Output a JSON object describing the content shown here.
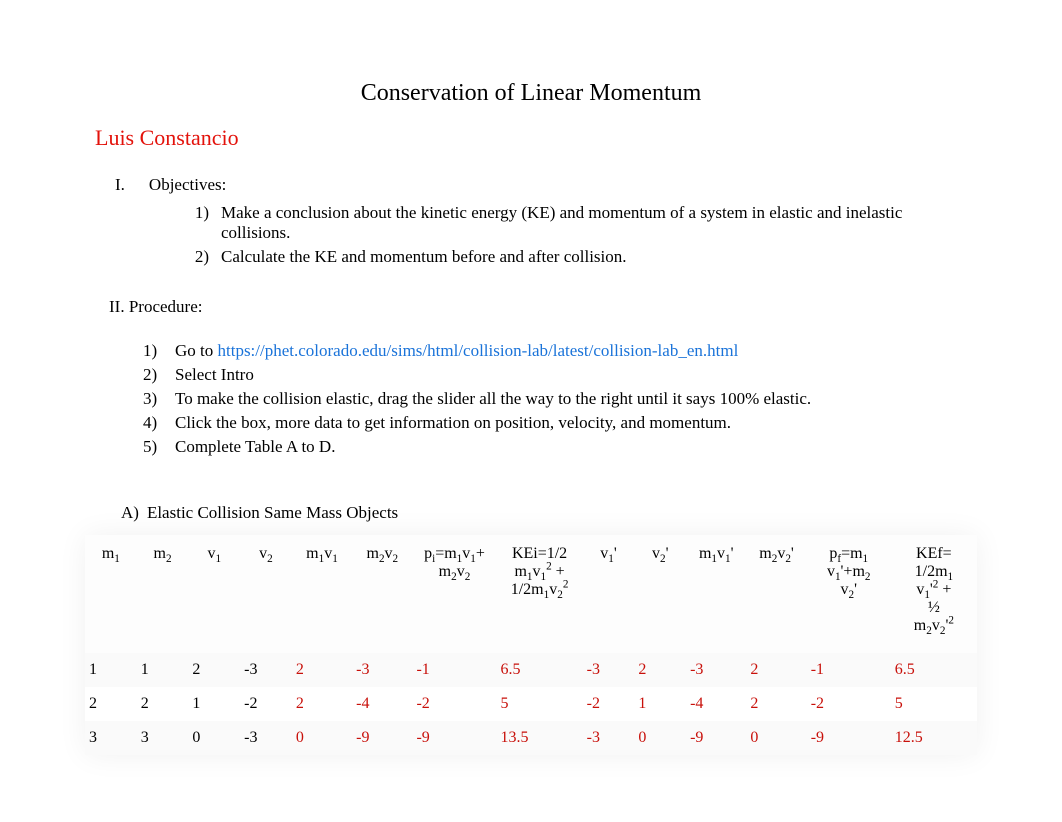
{
  "title": "Conservation of Linear Momentum",
  "author": "Luis Constancio",
  "obj_roman": "I.",
  "obj_label": "Objectives:",
  "objectives": [
    {
      "n": "1)",
      "text": "Make a conclusion about the kinetic energy (KE) and momentum of a system in elastic and inelastic collisions."
    },
    {
      "n": "2)",
      "text": "Calculate the KE and momentum before and after collision."
    }
  ],
  "proc_label": "II. Procedure:",
  "proc_items": [
    {
      "n": "1)",
      "pre": "Go to  ",
      "link": "https://phet.colorado.edu/sims/html/collision-lab/latest/collision-lab_en.html",
      "post": ""
    },
    {
      "n": "2)",
      "text": "Select Intro"
    },
    {
      "n": "3)",
      "text": "To make the collision elastic, drag the slider all the way to the right until it says 100% elastic."
    },
    {
      "n": "4)",
      "text": "Click the box, more data to get information on position, velocity, and momentum."
    },
    {
      "n": "5)",
      "text": "Complete Table A to D."
    }
  ],
  "tableA_letter": "A)",
  "tableA_title": "Elastic Collision Same Mass Objects",
  "chart_data": {
    "type": "table",
    "columns_plain": [
      "m1",
      "m2",
      "v1",
      "v2",
      "m1v1",
      "m2v2",
      "pi=m1v1+m2v2",
      "KEi=1/2m1v1^2+1/2m1v2^2",
      "v1'",
      "v2'",
      "m1v1'",
      "m2v2'",
      "pf=m1v1'+m2v2'",
      "KEf=1/2m1v1'^2+1/2m2v2'^2"
    ],
    "rows": [
      {
        "m1": "1",
        "m2": "1",
        "v1": "2",
        "v2": "-3",
        "m1v1": "2",
        "m2v2": "-3",
        "pi": "-1",
        "KEi": "6.5",
        "v1p": "-3",
        "v2p": "2",
        "m1v1p": "-3",
        "m2v2p": "2",
        "pf": "-1",
        "KEf": "6.5"
      },
      {
        "m1": "2",
        "m2": "2",
        "v1": "1",
        "v2": "-2",
        "m1v1": "2",
        "m2v2": "-4",
        "pi": "-2",
        "KEi": "5",
        "v1p": "-2",
        "v2p": "1",
        "m1v1p": "-4",
        "m2v2p": "2",
        "pf": "-2",
        "KEf": "5"
      },
      {
        "m1": "3",
        "m2": "3",
        "v1": "0",
        "v2": "-3",
        "m1v1": "0",
        "m2v2": "-9",
        "pi": "-9",
        "KEi": "13.5",
        "v1p": "-3",
        "v2p": "0",
        "m1v1p": "-9",
        "m2v2p": "0",
        "pf": "-9",
        "KEf": "12.5"
      }
    ],
    "red_columns": [
      "m1v1",
      "m2v2",
      "pi",
      "KEi",
      "v1p",
      "v2p",
      "m1v1p",
      "m2v2p",
      "pf",
      "KEf"
    ]
  }
}
